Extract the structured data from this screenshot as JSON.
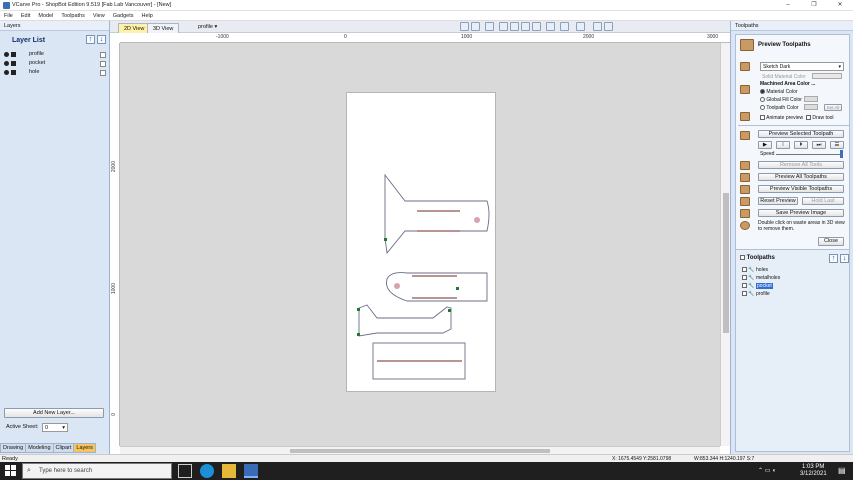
{
  "window": {
    "title": "VCarve Pro - ShopBot Edition 9.519 [Fab Lab Vancouver] - [New]",
    "controls": [
      "–",
      "❐",
      "✕"
    ]
  },
  "menu": [
    "File",
    "Edit",
    "Model",
    "Toolpaths",
    "View",
    "Gadgets",
    "Help"
  ],
  "left_panel": {
    "header": "Layers",
    "title": "Layer List",
    "layers": [
      {
        "name": "profile",
        "color": "#111111"
      },
      {
        "name": "pocket",
        "color": "#111111"
      },
      {
        "name": "hole",
        "color": "#111111"
      }
    ],
    "add_layer_label": "Add New Layer...",
    "active_sheet_label": "Active Sheet:",
    "active_sheet_value": "0",
    "tabs": [
      "Drawing",
      "Modeling",
      "Clipart",
      "Layers"
    ],
    "active_tab": "Layers"
  },
  "view": {
    "tabs": [
      "2D View",
      "3D View"
    ],
    "profile_selector": "profile",
    "ruler_top": [
      "-1000",
      "0",
      "1000",
      "2000",
      "3000"
    ],
    "ruler_left": [
      "2000",
      "1000",
      "0"
    ]
  },
  "right_panel": {
    "header": "Toolpaths",
    "preview_title": "Preview Toolpaths",
    "material_select": "Sketch Dark",
    "solid_material_color": "Solid Material Color",
    "machined_area_color": "Machined Area Color ...",
    "material_color_opt": "Material Color",
    "global_fill_opt": "Global Fill Color",
    "toolpath_color_opt": "Toolpath Color",
    "set_all": "Set All",
    "animate_preview": "Animate preview",
    "draw_tool": "Draw tool",
    "preview_selected": "Preview Selected Toolpath",
    "speed_label": "Speed",
    "reset_all_label": "Remove All Tools",
    "preview_all": "Preview All Toolpaths",
    "preview_visible": "Preview Visible Toolpaths",
    "reset_preview": "Reset Preview",
    "hold_last": "Hold Last",
    "save_image": "Save Preview Image",
    "hint": "Double click on waste areas in 3D view to remove them.",
    "close": "Close",
    "toolpaths_title": "Toolpaths",
    "toolpaths": [
      {
        "name": "holes",
        "checked": true,
        "selected": false
      },
      {
        "name": "metalholes",
        "checked": true,
        "selected": false
      },
      {
        "name": "pocket",
        "checked": true,
        "selected": true
      },
      {
        "name": "profile",
        "checked": true,
        "selected": false
      }
    ]
  },
  "status": {
    "left": "Ready",
    "coords": "X: 1675.4549 Y:2581.0798",
    "size": "W:853.344  H:1240.197  S:7"
  },
  "taskbar": {
    "search_placeholder": "Type here to search",
    "time": "1:03 PM",
    "date": "3/12/2021"
  }
}
